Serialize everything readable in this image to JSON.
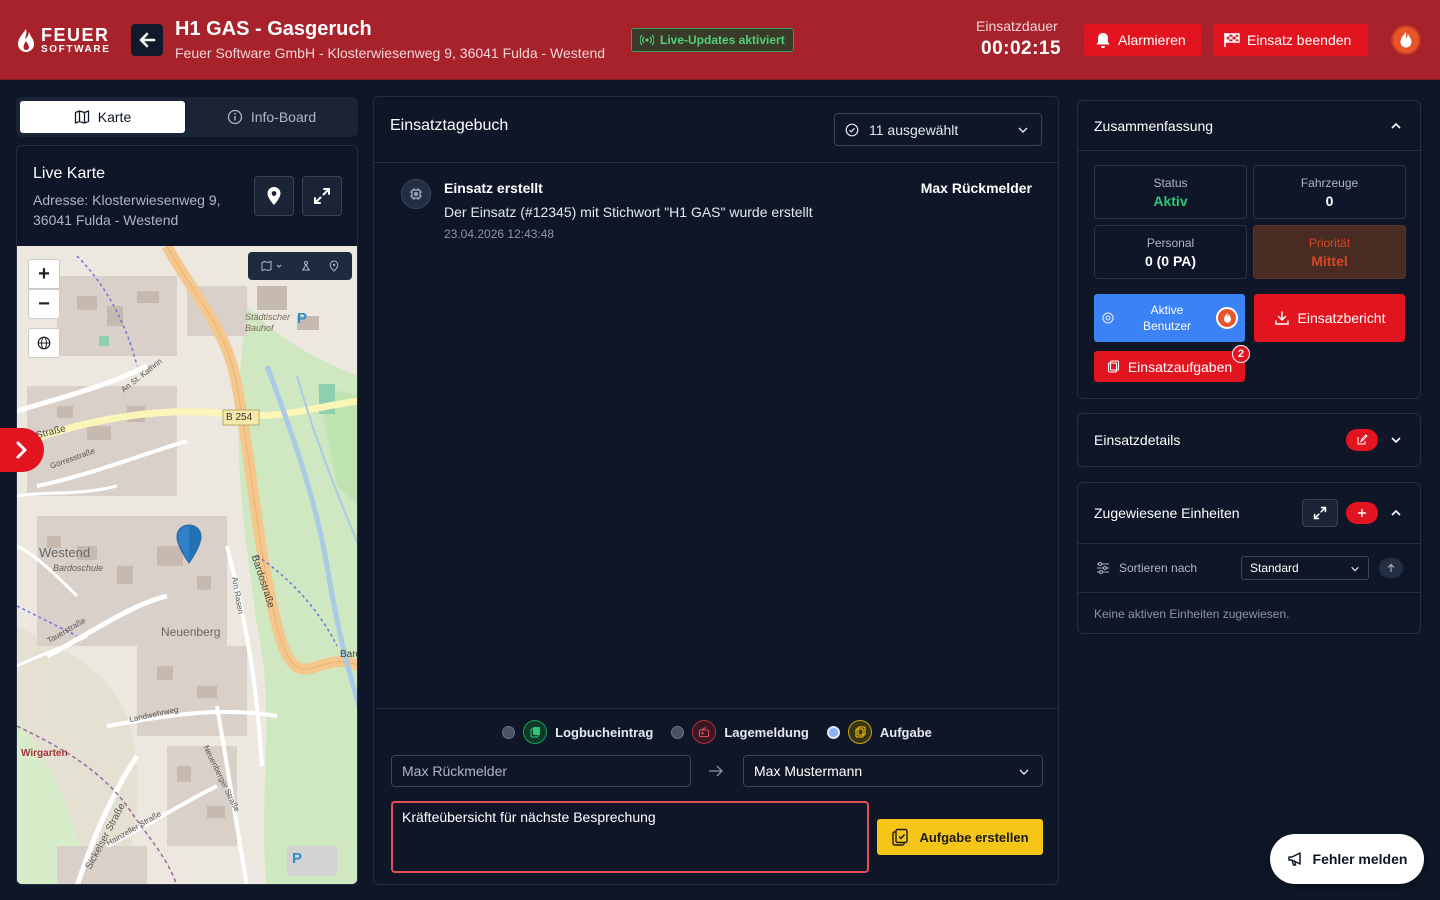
{
  "header": {
    "logo_line1": "FEUER",
    "logo_line2": "SOFTWARE",
    "title": "H1 GAS - Gasgeruch",
    "subtitle": "Feuer Software GmbH - Klosterwiesenweg 9, 36041 Fulda - Westend",
    "live_badge": "Live-Updates aktiviert",
    "duration_label": "Einsatzdauer",
    "duration_value": "00:02:15",
    "alarm_label": "Alarmieren",
    "end_label": "Einsatz beenden",
    "colors": {
      "header_bg": "#a8222c",
      "accent_red": "#e2141f",
      "live_green": "#4fd07a"
    }
  },
  "left": {
    "tabs": [
      {
        "label": "Karte",
        "active": true
      },
      {
        "label": "Info-Board",
        "active": false
      }
    ],
    "live_map_title": "Live Karte",
    "address": "Adresse: Klosterwiesenweg 9, 36041 Fulda - Westend",
    "map_labels": {
      "road_b254": "B 254",
      "westend": "Westend",
      "bardoschule": "Bardoschule",
      "neuenberg": "Neuenberg",
      "wirgarten": "Wirgarten",
      "bauhof": "Städtischer Bauhof",
      "bardostrasse": "Bardostraße",
      "am_rasen": "Am Rasen",
      "an_st_kathrin": "An St. Kathrin",
      "goerresstrasse": "Görresstraße",
      "her_strasse": "her Straße",
      "tauerstrasse": "Tauerstraße",
      "landwehrweg": "Landwehrweg",
      "neuenberger_strasse": "Neuenberger Straße",
      "sickelser_strasse": "Sickelser Straße",
      "hainzeller_strasse": "Hainzeller Straße",
      "parking": "P",
      "bard_edge": "Bard",
      "zoom_in": "+",
      "zoom_out": "−"
    }
  },
  "journal": {
    "title": "Einsatztagebuch",
    "filter_value": "11 ausgewählt",
    "entries": [
      {
        "title": "Einsatz erstellt",
        "author": "Max Rückmelder",
        "text": "Der Einsatz (#12345) mit Stichwort \"H1 GAS\" wurde erstellt",
        "timestamp": "23.04.2026 12:43:48"
      }
    ],
    "types": [
      {
        "label": "Logbucheintrag",
        "selected": false,
        "color": "#1e9e5a"
      },
      {
        "label": "Lagemeldung",
        "selected": false,
        "color": "#e2141f"
      },
      {
        "label": "Aufgabe",
        "selected": true,
        "color": "#f5c518"
      }
    ],
    "from_value": "Max Rückmelder",
    "to_value": "Max Mustermann",
    "task_text": "Kräfteübersicht für nächste Besprechung",
    "create_label": "Aufgabe erstellen"
  },
  "summary": {
    "title": "Zusammenfassung",
    "stats": {
      "status": {
        "label": "Status",
        "value": "Aktiv"
      },
      "vehicles": {
        "label": "Fahrzeuge",
        "value": "0"
      },
      "personnel": {
        "label": "Personal",
        "value": "0 (0 PA)"
      },
      "priority": {
        "label": "Priorität",
        "value": "Mittel"
      }
    },
    "active_users_label_1": "Aktive",
    "active_users_label_2": "Benutzer",
    "report_label": "Einsatzbericht",
    "tasks_label": "Einsatzaufgaben",
    "tasks_count": "2"
  },
  "details": {
    "title": "Einsatzdetails"
  },
  "units": {
    "title": "Zugewiesene Einheiten",
    "sort_label": "Sortieren nach",
    "sort_value": "Standard",
    "empty": "Keine aktiven Einheiten zugewiesen."
  },
  "report_error_label": "Fehler melden"
}
